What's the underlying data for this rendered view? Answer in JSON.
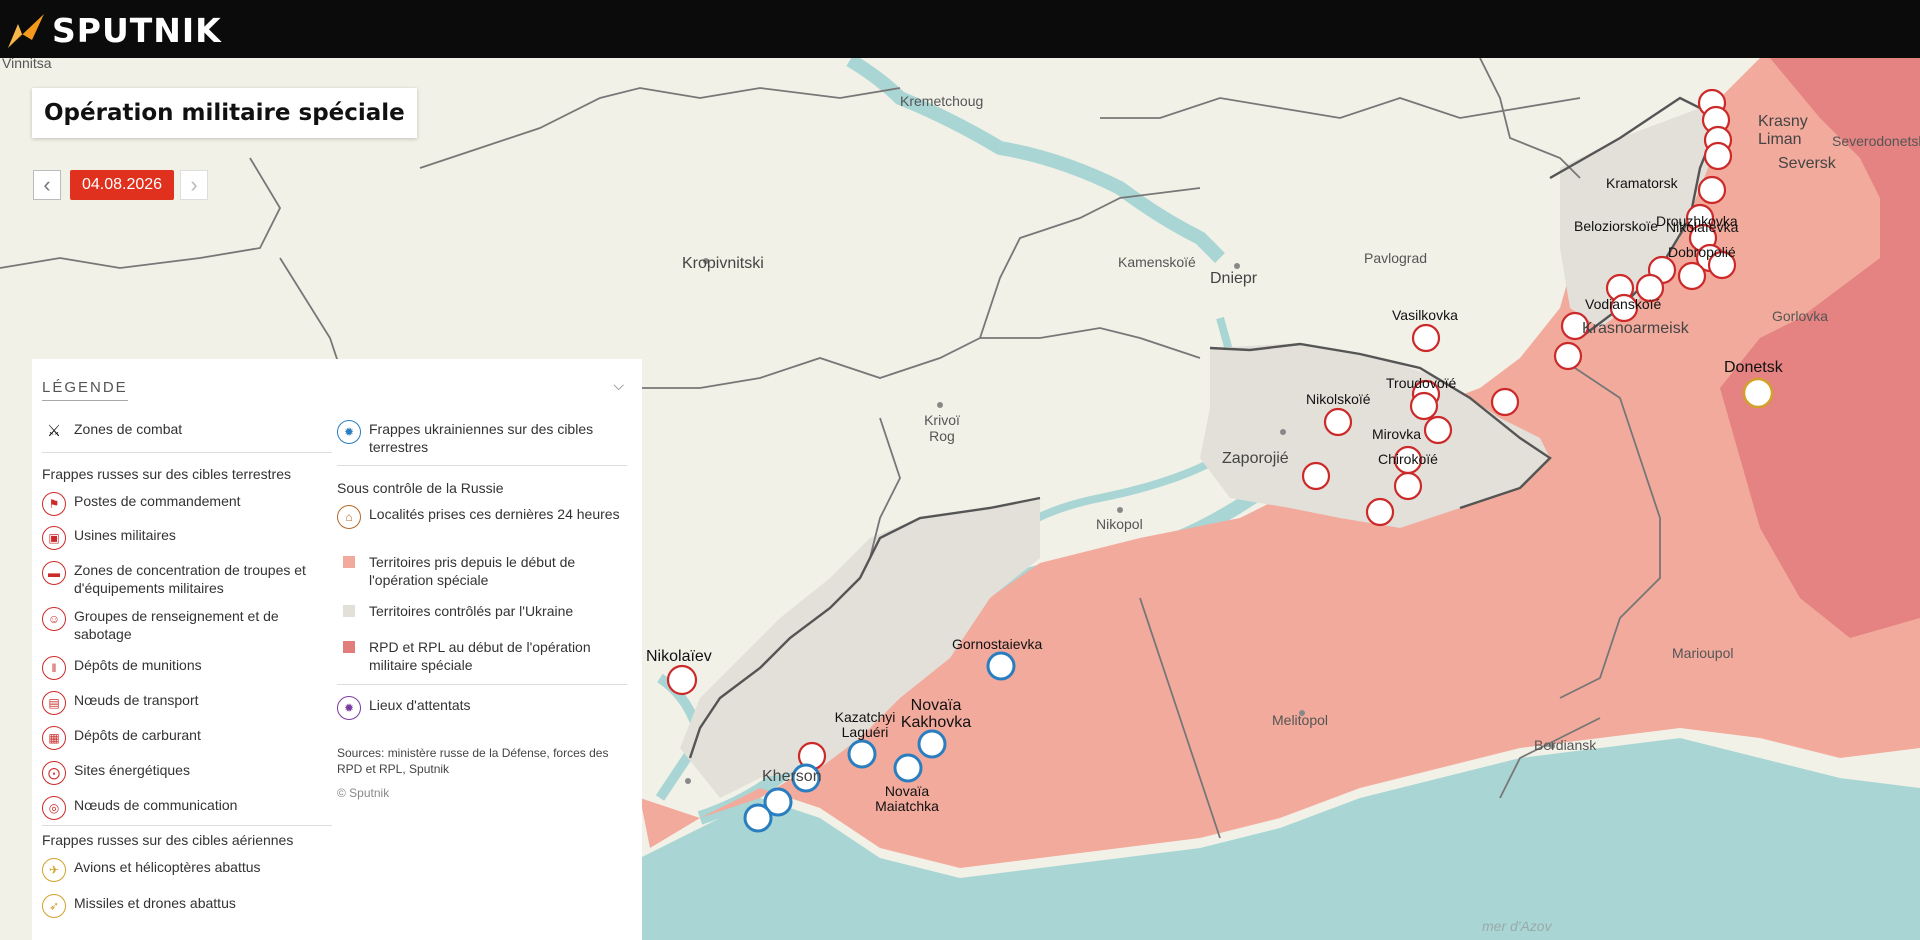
{
  "header": {
    "brand": "SPUTNIK"
  },
  "map_title": "Opération militaire spéciale",
  "date": "04.08.2026",
  "nav": {
    "prev": "‹",
    "next": "›"
  },
  "legend": {
    "title": "LÉGENDE",
    "combat": "Zones de combat",
    "ukr_strikes": "Frappes ukrainiennes sur des cibles terrestres",
    "ground_section": "Frappes russes sur des cibles terrestres",
    "ground_items": [
      "Postes de commandement",
      "Usines militaires",
      "Zones de concentration de troupes et d'équipements militaires",
      "Groupes de renseignement et de sabotage",
      "Dépôts de munitions",
      "Nœuds de transport",
      "Dépôts de carburant",
      "Sites énergétiques",
      "Nœuds de communication"
    ],
    "air_section": "Frappes russes sur des cibles aériennes",
    "air_items": [
      "Avions et hélicoptères abattus",
      "Missiles et drones abattus"
    ],
    "control_section": "Sous contrôle de la Russie",
    "control_items": [
      "Localités prises ces dernières 24 heures",
      "Territoires pris depuis le début de l'opération spéciale",
      "Territoires contrôlés par l'Ukraine",
      "RPD et RPL au début de l'opération militaire spéciale"
    ],
    "attacks": "Lieux d'attentats",
    "sources": "Sources: ministère russe de la Défense, forces des RPD et RPL, Sputnik",
    "copyright": "© Sputnik"
  },
  "colors": {
    "russia_controlled": "#f2aa9c",
    "ukraine_controlled": "#e3e0da",
    "dpr_lpr_initial": "#e27d7d",
    "water": "#a9d6d4",
    "accent_red": "#e0301e",
    "strike_blue": "#2a7ec0"
  },
  "cities": [
    "Vinnitsa",
    "Kremetchoug",
    "Kropivnitski",
    "Kamenskoïé",
    "Dniepr",
    "Pavlograd",
    "Krasny Liman",
    "Severodonetsk",
    "Seversk",
    "Kramatorsk",
    "Drouzhkovka",
    "Beloziorskoïe",
    "Nikolaïevka",
    "Dobropolié",
    "Vodianskoïé",
    "Krasnoarmeisk",
    "Gorlovka",
    "Vasilkovka",
    "Donetsk",
    "Troudovoïé",
    "Nikolskoïé",
    "Mirovka",
    "Chirokoïé",
    "Zaporojié",
    "Krivoï Rog",
    "Nikopol",
    "Nikolaïev",
    "Gornostaievka",
    "Kazatchyi Laguéri",
    "Novaïa Kakhovka",
    "Kherson",
    "Novaïa Maiatchka",
    "Melitopol",
    "Berdiansk",
    "Marioupol",
    "mer d'Azov"
  ]
}
